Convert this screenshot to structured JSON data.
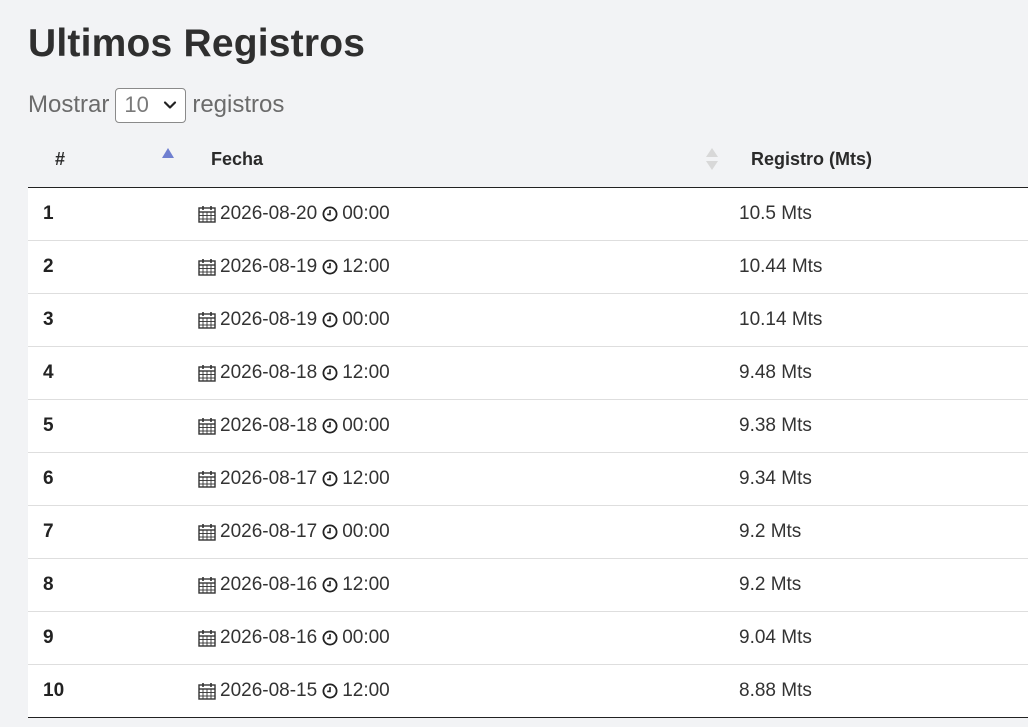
{
  "page": {
    "title": "Ultimos Registros"
  },
  "length_control": {
    "prefix": "Mostrar",
    "selected": "10",
    "suffix": "registros"
  },
  "table": {
    "headers": [
      "#",
      "Fecha",
      "Registro (Mts)"
    ],
    "sort": {
      "column": "#",
      "direction": "asc"
    },
    "rows": [
      {
        "index": "1",
        "date": "2026-08-20",
        "time": "00:00",
        "value": "10.5 Mts"
      },
      {
        "index": "2",
        "date": "2026-08-19",
        "time": "12:00",
        "value": "10.44 Mts"
      },
      {
        "index": "3",
        "date": "2026-08-19",
        "time": "00:00",
        "value": "10.14 Mts"
      },
      {
        "index": "4",
        "date": "2026-08-18",
        "time": "12:00",
        "value": "9.48 Mts"
      },
      {
        "index": "5",
        "date": "2026-08-18",
        "time": "00:00",
        "value": "9.38 Mts"
      },
      {
        "index": "6",
        "date": "2026-08-17",
        "time": "12:00",
        "value": "9.34 Mts"
      },
      {
        "index": "7",
        "date": "2026-08-17",
        "time": "00:00",
        "value": "9.2 Mts"
      },
      {
        "index": "8",
        "date": "2026-08-16",
        "time": "12:00",
        "value": "9.2 Mts"
      },
      {
        "index": "9",
        "date": "2026-08-16",
        "time": "00:00",
        "value": "9.04 Mts"
      },
      {
        "index": "10",
        "date": "2026-08-15",
        "time": "12:00",
        "value": "8.88 Mts"
      }
    ]
  },
  "icons": {
    "date": "calendar-icon",
    "time": "clock-icon",
    "sort_active": "sort-asc-icon",
    "sort_inactive": "sort-both-icon",
    "select": "chevron-down-icon"
  },
  "colors": {
    "background": "#f2f3f5",
    "sort_active": "#6f7fd0",
    "sort_inactive": "#d0d0d0"
  }
}
